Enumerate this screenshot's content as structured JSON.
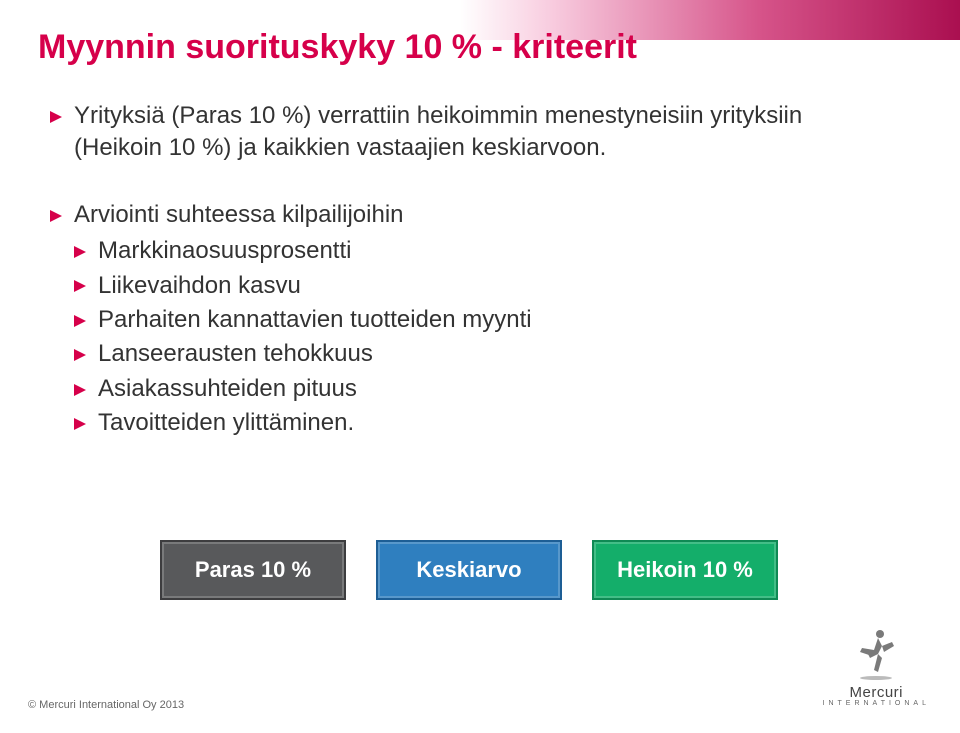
{
  "title": "Myynnin suorituskyky 10 % - kriteerit",
  "intro": "Yrityksiä (Paras 10 %) verrattiin heikoimmin menestyneisiin yrityksiin (Heikoin 10 %) ja kaikkien vastaajien keskiarvoon.",
  "list_heading": "Arviointi suhteessa kilpailijoihin",
  "items": [
    "Markkinaosuusprosentti",
    "Liikevaihdon kasvu",
    "Parhaiten kannattavien tuotteiden myynti",
    "Lanseerausten tehokkuus",
    "Asiakassuhteiden pituus",
    "Tavoitteiden ylittäminen."
  ],
  "badges": {
    "paras": "Paras 10 %",
    "keskiarvo": "Keskiarvo",
    "heikoin": "Heikoin 10 %"
  },
  "footer": "© Mercuri International Oy 2013",
  "logo": {
    "top": "Mercuri",
    "bottom": "INTERNATIONAL"
  }
}
